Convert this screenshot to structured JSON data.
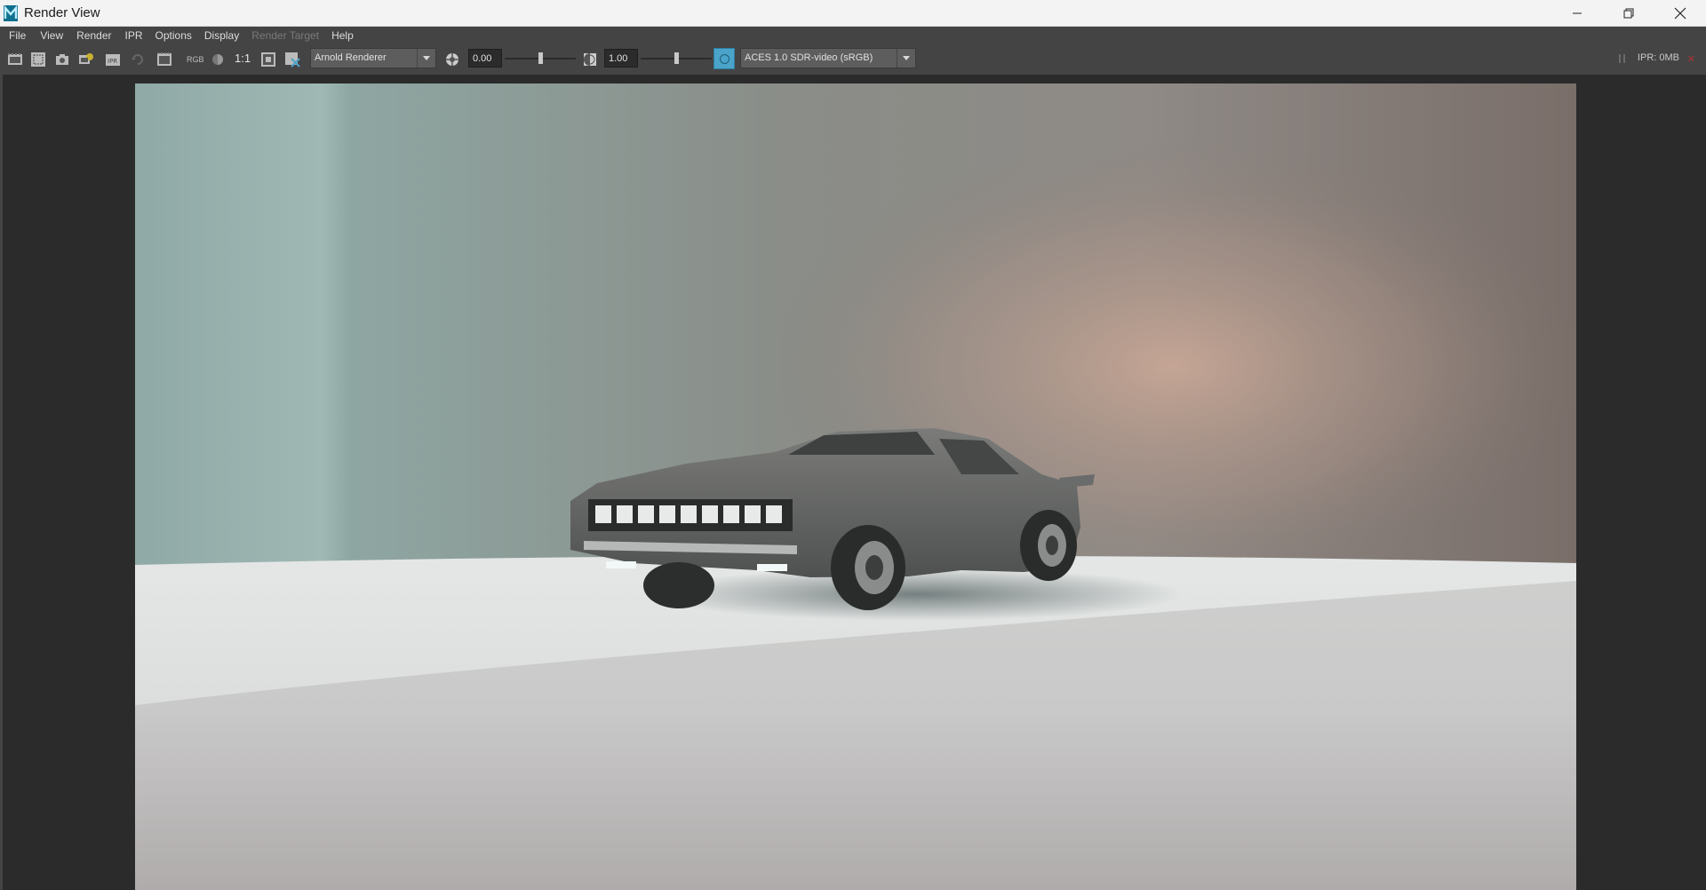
{
  "window": {
    "title": "Render View",
    "app_icon": "maya-logo-icon",
    "controls": [
      "minimize-icon",
      "restore-icon",
      "close-icon"
    ]
  },
  "menubar": {
    "items": [
      {
        "label": "File",
        "enabled": true
      },
      {
        "label": "View",
        "enabled": true
      },
      {
        "label": "Render",
        "enabled": true
      },
      {
        "label": "IPR",
        "enabled": true
      },
      {
        "label": "Options",
        "enabled": true
      },
      {
        "label": "Display",
        "enabled": true
      },
      {
        "label": "Render Target",
        "enabled": false
      },
      {
        "label": "Help",
        "enabled": true
      }
    ]
  },
  "toolbar": {
    "icons": [
      "render-frame-icon",
      "render-region-icon",
      "snapshot-icon",
      "ipr-render-icon",
      "ipr-render-region-icon",
      "refresh-icon",
      "keep-image-icon"
    ],
    "rgb_label": "RGB",
    "one_to_one_label": "1:1",
    "renderer": {
      "value": "Arnold Renderer",
      "options": [
        "Arnold Renderer"
      ]
    },
    "exposure": {
      "value": "0.00",
      "slider_fraction": 0.5
    },
    "gamma": {
      "value": "1.00",
      "slider_fraction": 0.5
    },
    "view_transform": {
      "value": "ACES 1.0 SDR-video (sRGB)",
      "enabled": true
    },
    "ipr_status": "IPR: 0MB",
    "accent_color": "#4aa4c9"
  },
  "render": {
    "description_icon": "car-render-image",
    "background_colors": {
      "teal": "#98b1ae",
      "warm": "#c2a395",
      "floor": "#d8dada"
    }
  }
}
